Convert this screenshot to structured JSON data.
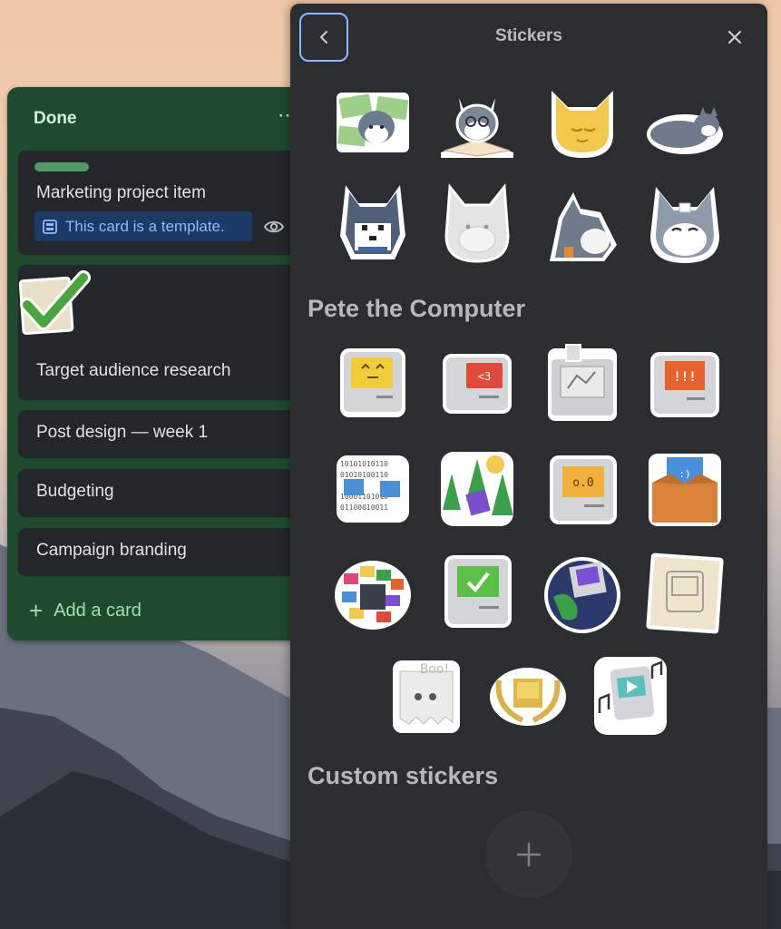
{
  "list": {
    "title": "Done",
    "menu_icon": "more-icon",
    "cards": [
      {
        "title": "Marketing project item",
        "has_label": true,
        "label_color": "#4f9a68",
        "template_badge": "This card is a template."
      },
      {
        "title": "Target audience research",
        "sticker": "checkmark-sticker"
      },
      {
        "title": "Post design — week 1"
      },
      {
        "title": "Budgeting"
      },
      {
        "title": "Campaign branding"
      }
    ],
    "add_card_label": "Add a card"
  },
  "panel": {
    "title": "Stickers",
    "back_icon": "chevron-left-icon",
    "close_icon": "close-icon",
    "sections": [
      {
        "title": "",
        "stickers": [
          "husky-money",
          "husky-reading",
          "golden-cat",
          "husky-sleeping",
          "pixel-husky",
          "white-husky-outline",
          "husky-side",
          "husky-smiling"
        ]
      },
      {
        "title": "Pete the Computer",
        "stickers": [
          "pete-happy",
          "pete-heart",
          "pete-broken",
          "pete-alarm",
          "pete-binary",
          "pete-trees",
          "pete-surprised",
          "pete-box",
          "pete-colorful",
          "pete-checkmark",
          "pete-globe",
          "pete-sketch",
          "pete-ghost",
          "pete-trophy",
          "pete-music"
        ]
      },
      {
        "title": "Custom stickers",
        "stickers": []
      }
    ],
    "add_custom_icon": "plus-icon"
  },
  "colors": {
    "list_bg": "#1f4a2e",
    "card_bg": "#23262b",
    "panel_bg": "#2c2d30",
    "accent": "#8fb6ff"
  }
}
